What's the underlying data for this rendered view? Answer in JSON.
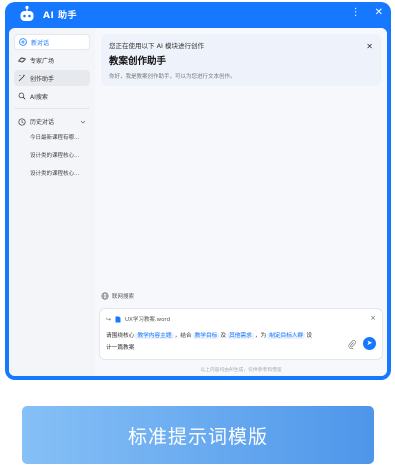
{
  "app": {
    "brand": "AI 助手"
  },
  "window_controls": {
    "more": "⋮",
    "close": "✕"
  },
  "sidebar": {
    "new_chat": "新对话",
    "items": [
      {
        "label": "专家广场"
      },
      {
        "label": "创作助手"
      },
      {
        "label": "AI搜索"
      }
    ],
    "history_title": "历史对话",
    "history": [
      {
        "label": "今日最新课程有哪..."
      },
      {
        "label": "设计类的课程核心..."
      },
      {
        "label": "设计类的课程核心..."
      }
    ]
  },
  "banner": {
    "subtitle": "您正在使用以下 AI 模块进行创作",
    "title": "教案创作助手",
    "desc": "你好，我是教案创作助手，可以为您进行文本创作。"
  },
  "web_search": "联网搜索",
  "input": {
    "file_name": "UX学习教案.word",
    "prompt_parts": {
      "p1": "请围绕核心",
      "h1": "教学内容主题",
      "p2": "，结合",
      "h2": "教学目标",
      "p3": "及",
      "h3": "其他需求",
      "p4": "，为",
      "h4": "制定目标人群",
      "p5": "设计一篇教案"
    }
  },
  "disclaimer": "以上内容均由AI生成，仅供参考和借鉴",
  "cta": {
    "label": "标准提示词模版"
  },
  "colors": {
    "accent": "#1677ff",
    "cta_start": "#86c0f6",
    "cta_end": "#4e96ea"
  }
}
